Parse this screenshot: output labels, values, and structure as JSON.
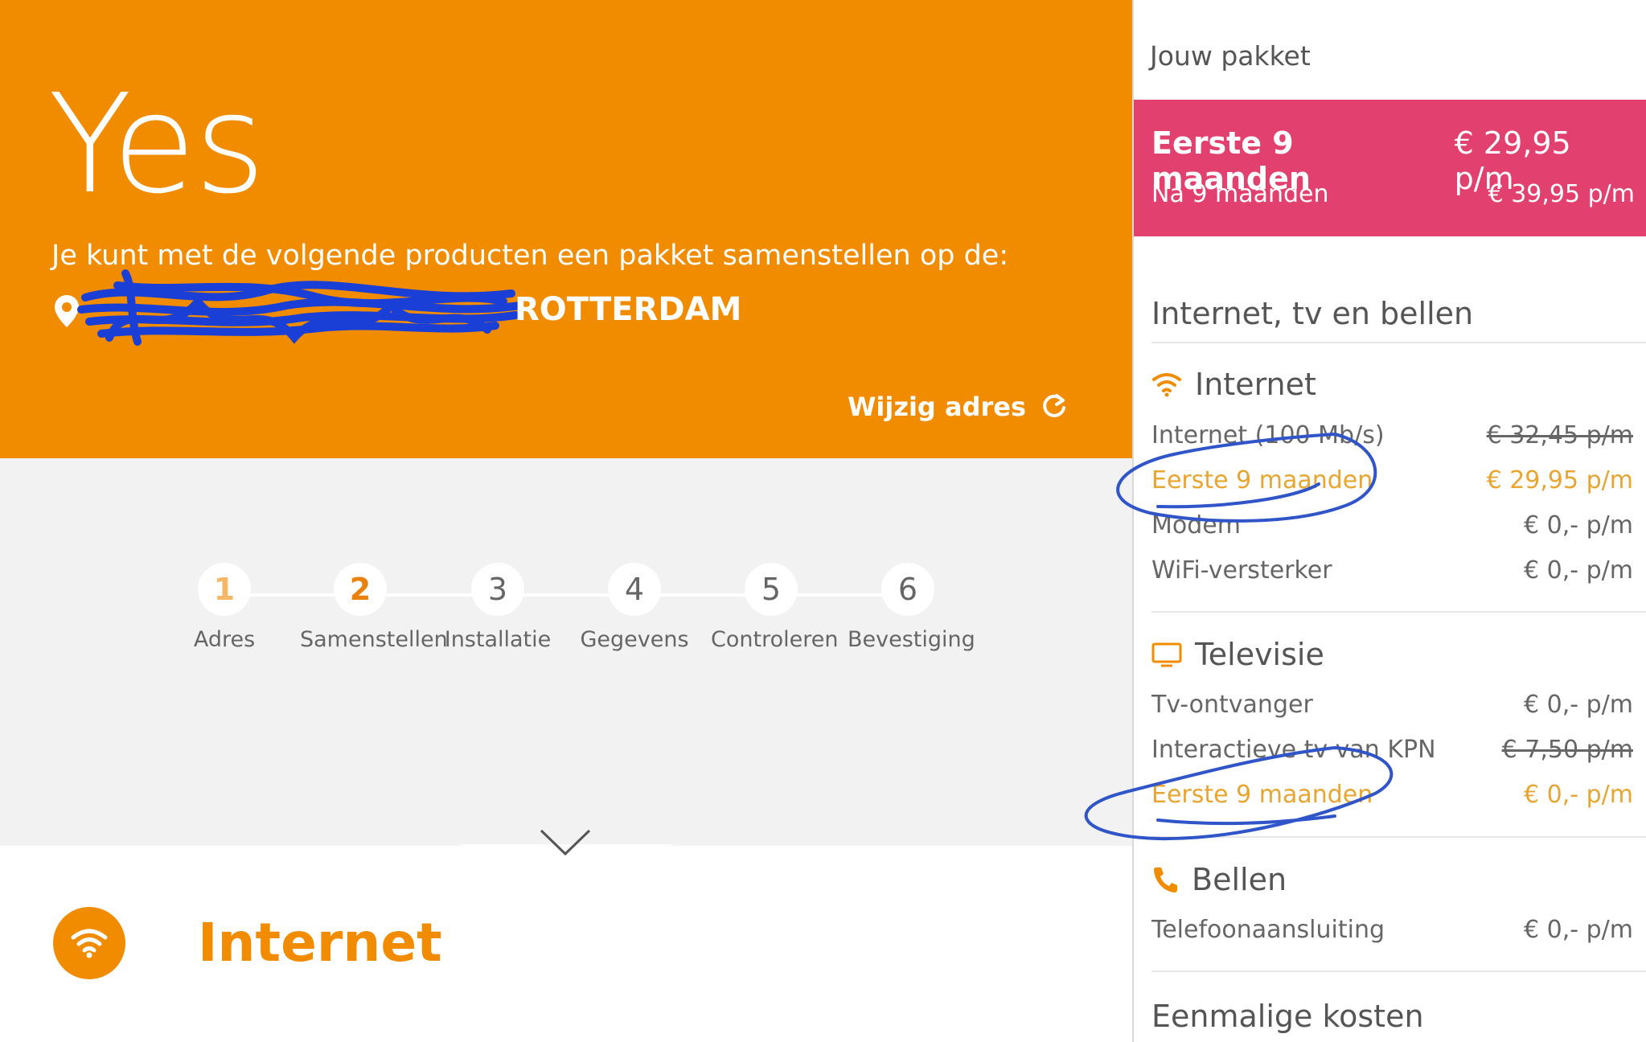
{
  "hero": {
    "title": "Yes",
    "subtitle": "Je kunt met de volgende producten een pakket samenstellen op de:",
    "city": "ROTTERDAM",
    "change_address": "Wijzig adres"
  },
  "steps": [
    {
      "num": "1",
      "label": "Adres",
      "state": "done"
    },
    {
      "num": "2",
      "label": "Samenstellen",
      "state": "current"
    },
    {
      "num": "3",
      "label": "Installatie",
      "state": "todo"
    },
    {
      "num": "4",
      "label": "Gegevens",
      "state": "todo"
    },
    {
      "num": "5",
      "label": "Controleren",
      "state": "todo"
    },
    {
      "num": "6",
      "label": "Bevestiging",
      "state": "todo"
    }
  ],
  "section": {
    "title": "Internet",
    "icon": "wifi-icon"
  },
  "sidebar": {
    "heading": "Jouw pakket",
    "promo": {
      "first_label": "Eerste 9 maanden",
      "first_price": "€ 29,95 p/m",
      "after_label": "Na 9 maanden",
      "after_price": "€ 39,95 p/m"
    },
    "group_title": "Internet, tv en bellen",
    "internet": {
      "title": "Internet",
      "icon": "wifi-icon",
      "lines": [
        {
          "label": "Internet (100 Mb/s)",
          "price": "€ 32,45 p/m"
        },
        {
          "label": "Eerste 9 maanden",
          "price": "€ 29,95 p/m"
        },
        {
          "label": "Modem",
          "price": "€ 0,- p/m"
        },
        {
          "label": "WiFi-versterker",
          "price": "€ 0,- p/m"
        }
      ]
    },
    "tv": {
      "title": "Televisie",
      "icon": "tv-icon",
      "lines": [
        {
          "label": "Tv-ontvanger",
          "price": "€ 0,- p/m"
        },
        {
          "label": "Interactieve tv van KPN",
          "price": "€ 7,50 p/m"
        },
        {
          "label": "Eerste 9 maanden",
          "price": "€ 0,- p/m"
        }
      ]
    },
    "phone": {
      "title": "Bellen",
      "icon": "phone-icon",
      "lines": [
        {
          "label": "Telefoonaansluiting",
          "price": "€ 0,- p/m"
        }
      ]
    },
    "one_time_title": "Eenmalige kosten"
  },
  "colors": {
    "brand_orange": "#F18C00",
    "promo_pink": "#E2406E",
    "promo_text": "#E8A530",
    "annotation_blue": "#2F55C8"
  }
}
